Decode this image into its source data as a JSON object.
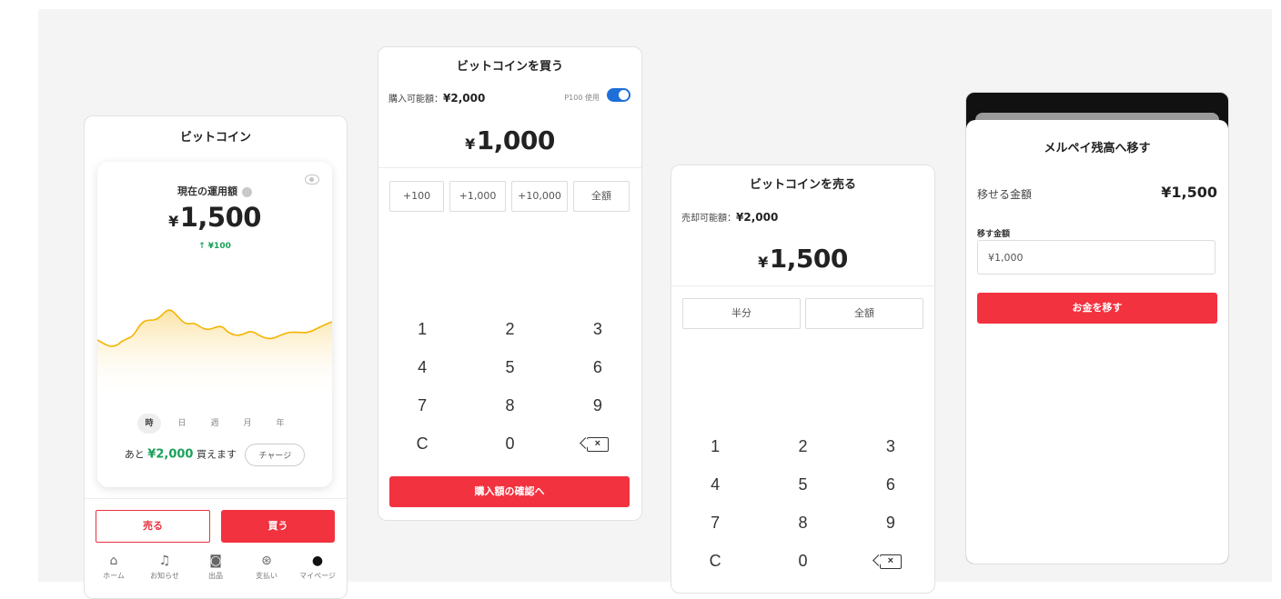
{
  "screen1": {
    "title": "ビットコイン",
    "card_label": "現在の運用額",
    "yen_mark": "¥",
    "amount": "1,500",
    "change": "↑ ¥100",
    "periods": [
      "時",
      "日",
      "週",
      "月",
      "年"
    ],
    "active_period": "時",
    "remain_prefix": "あと",
    "remain_amount": "¥2,000",
    "remain_suffix": "買えます",
    "charge_label": "チャージ",
    "sell_label": "売る",
    "buy_label": "買う",
    "tabs": [
      {
        "label": "ホーム",
        "icon": "home-icon",
        "glyph": "⌂"
      },
      {
        "label": "お知らせ",
        "icon": "bell-icon",
        "glyph": "♫"
      },
      {
        "label": "出品",
        "icon": "camera-icon",
        "glyph": "◙"
      },
      {
        "label": "支払い",
        "icon": "yen-circle-icon",
        "glyph": "⊛"
      },
      {
        "label": "マイページ",
        "icon": "person-icon",
        "glyph": "●"
      }
    ],
    "chart_colors": {
      "line": "#f4b400",
      "fill_top": "#fbe3a4",
      "fill_bottom": "#ffffff"
    }
  },
  "screen2": {
    "title": "ビットコインを買う",
    "available_label": "購入可能額：",
    "available_amount": "¥2,000",
    "point_label": "P100 使用",
    "point_toggle_on": true,
    "yen_mark": "¥",
    "amount": "1,000",
    "quick": [
      "+100",
      "+1,000",
      "+10,000",
      "全額"
    ],
    "keys": [
      "1",
      "2",
      "3",
      "4",
      "5",
      "6",
      "7",
      "8",
      "9",
      "C",
      "0",
      "⌫"
    ],
    "confirm_label": "購入額の確認へ"
  },
  "screen3": {
    "title": "ビットコインを売る",
    "available_label": "売却可能額：",
    "available_amount": "¥2,000",
    "yen_mark": "¥",
    "amount": "1,500",
    "quick": [
      "半分",
      "全額"
    ],
    "keys": [
      "1",
      "2",
      "3",
      "4",
      "5",
      "6",
      "7",
      "8",
      "9",
      "C",
      "0",
      "⌫"
    ]
  },
  "screen4": {
    "title": "メルペイ残高へ移す",
    "movable_label": "移せる金額",
    "movable_amount": "¥1,500",
    "field_label": "移す金額",
    "field_value": "¥1,000",
    "submit_label": "お金を移す"
  },
  "colors": {
    "accent_red": "#f2323f",
    "green": "#1aa05a",
    "toggle_blue": "#1e6fd9"
  }
}
